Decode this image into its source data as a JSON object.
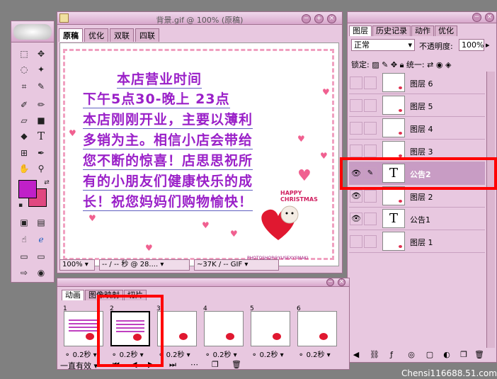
{
  "document": {
    "title": "背景.gif @ 100% (原稿)",
    "tabs": [
      "原稿",
      "优化",
      "双联",
      "四联"
    ],
    "canvas_lines": [
      "本店营业时间",
      "下午5点30-晚上 23点",
      "本店刚刚开业，主要以薄利",
      "多销为主。相信小店会带给",
      "您不断的惊喜！店思思祝所",
      "有的小朋友们健康快乐的成",
      "长！祝您妈妈们购物愉快！"
    ],
    "christmas_text": "HAPPY CHRISTMAS",
    "photoshop_tag": "PHOTOSHOP@YUSEXYSMAKI",
    "status": {
      "zoom": "100%",
      "time": "-- / -- 秒 @ 28....",
      "size": "~37K / -- GIF"
    }
  },
  "layers_panel": {
    "tabs": [
      "图层",
      "历史记录",
      "动作",
      "优化"
    ],
    "blend_mode": "正常",
    "opacity_label": "不透明度:",
    "opacity_value": "100%",
    "lock_label": "锁定:",
    "unify_label": "统一:",
    "layers": [
      {
        "name": "图层 6",
        "type": "image",
        "visible": false,
        "selected": false
      },
      {
        "name": "图层 5",
        "type": "image",
        "visible": false,
        "selected": false
      },
      {
        "name": "图层 4",
        "type": "image",
        "visible": false,
        "selected": false
      },
      {
        "name": "图层 3",
        "type": "image",
        "visible": false,
        "selected": false
      },
      {
        "name": "公告2",
        "type": "text",
        "visible": true,
        "selected": true
      },
      {
        "name": "图层 2",
        "type": "image",
        "visible": true,
        "selected": false
      },
      {
        "name": "公告1",
        "type": "text",
        "visible": true,
        "selected": false
      },
      {
        "name": "图层 1",
        "type": "image",
        "visible": false,
        "selected": false
      }
    ]
  },
  "animation_panel": {
    "tabs": [
      "动画",
      "图像映射",
      "切片"
    ],
    "frames": [
      {
        "number": "1",
        "time": "0.2秒"
      },
      {
        "number": "2",
        "time": "0.2秒"
      },
      {
        "number": "3",
        "time": "0.2秒"
      },
      {
        "number": "4",
        "time": "0.2秒"
      },
      {
        "number": "5",
        "time": "0.2秒"
      },
      {
        "number": "6",
        "time": "0.2秒"
      }
    ],
    "selected_frame": 2,
    "loop_option": "一直有效"
  },
  "watermark": "Chensi116688.51.com",
  "colors": {
    "foreground": "#c020c8",
    "background": "#e04880",
    "highlight_box": "#ff0000"
  }
}
